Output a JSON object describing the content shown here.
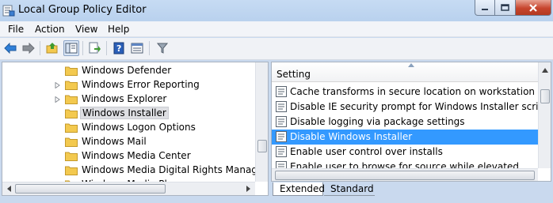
{
  "window": {
    "title": "Local Group Policy Editor",
    "icons": {
      "app": "policy-editor-icon",
      "minimize": "minimize-icon",
      "maximize": "maximize-icon",
      "close": "close-icon"
    }
  },
  "menu": [
    "File",
    "Action",
    "View",
    "Help"
  ],
  "toolbar": {
    "buttons": [
      "back-arrow-icon",
      "forward-arrow-icon",
      "up-folder-icon",
      "show-hide-tree-icon",
      "export-list-icon",
      "help-icon",
      "properties-view-icon",
      "filter-icon"
    ]
  },
  "tree": {
    "items": [
      {
        "label": "Windows Defender",
        "expander": false,
        "selected": false
      },
      {
        "label": "Windows Error Reporting",
        "expander": true,
        "selected": false
      },
      {
        "label": "Windows Explorer",
        "expander": true,
        "selected": false
      },
      {
        "label": "Windows Installer",
        "expander": false,
        "selected": true
      },
      {
        "label": "Windows Logon Options",
        "expander": false,
        "selected": false
      },
      {
        "label": "Windows Mail",
        "expander": false,
        "selected": false
      },
      {
        "label": "Windows Media Center",
        "expander": false,
        "selected": false
      },
      {
        "label": "Windows Media Digital Rights Manageme",
        "expander": false,
        "selected": false
      },
      {
        "label": "Windows Media Pl...",
        "expander": false,
        "selected": false
      }
    ]
  },
  "settings": {
    "column_header": "Setting",
    "rows": [
      {
        "label": "Cache transforms in secure location on workstation",
        "selected": false
      },
      {
        "label": "Disable IE security prompt for Windows Installer scripts",
        "selected": false
      },
      {
        "label": "Disable logging via package settings",
        "selected": false
      },
      {
        "label": "Disable Windows Installer",
        "selected": true
      },
      {
        "label": "Enable user control over installs",
        "selected": false
      },
      {
        "label": "Enable user to browse for source while elevated",
        "selected": false
      }
    ]
  },
  "tabs": [
    "Extended",
    "Standard"
  ],
  "colors": {
    "selection": "#3399ff",
    "folder": "#f3c94f",
    "titlebar": "#c6dbf3"
  }
}
